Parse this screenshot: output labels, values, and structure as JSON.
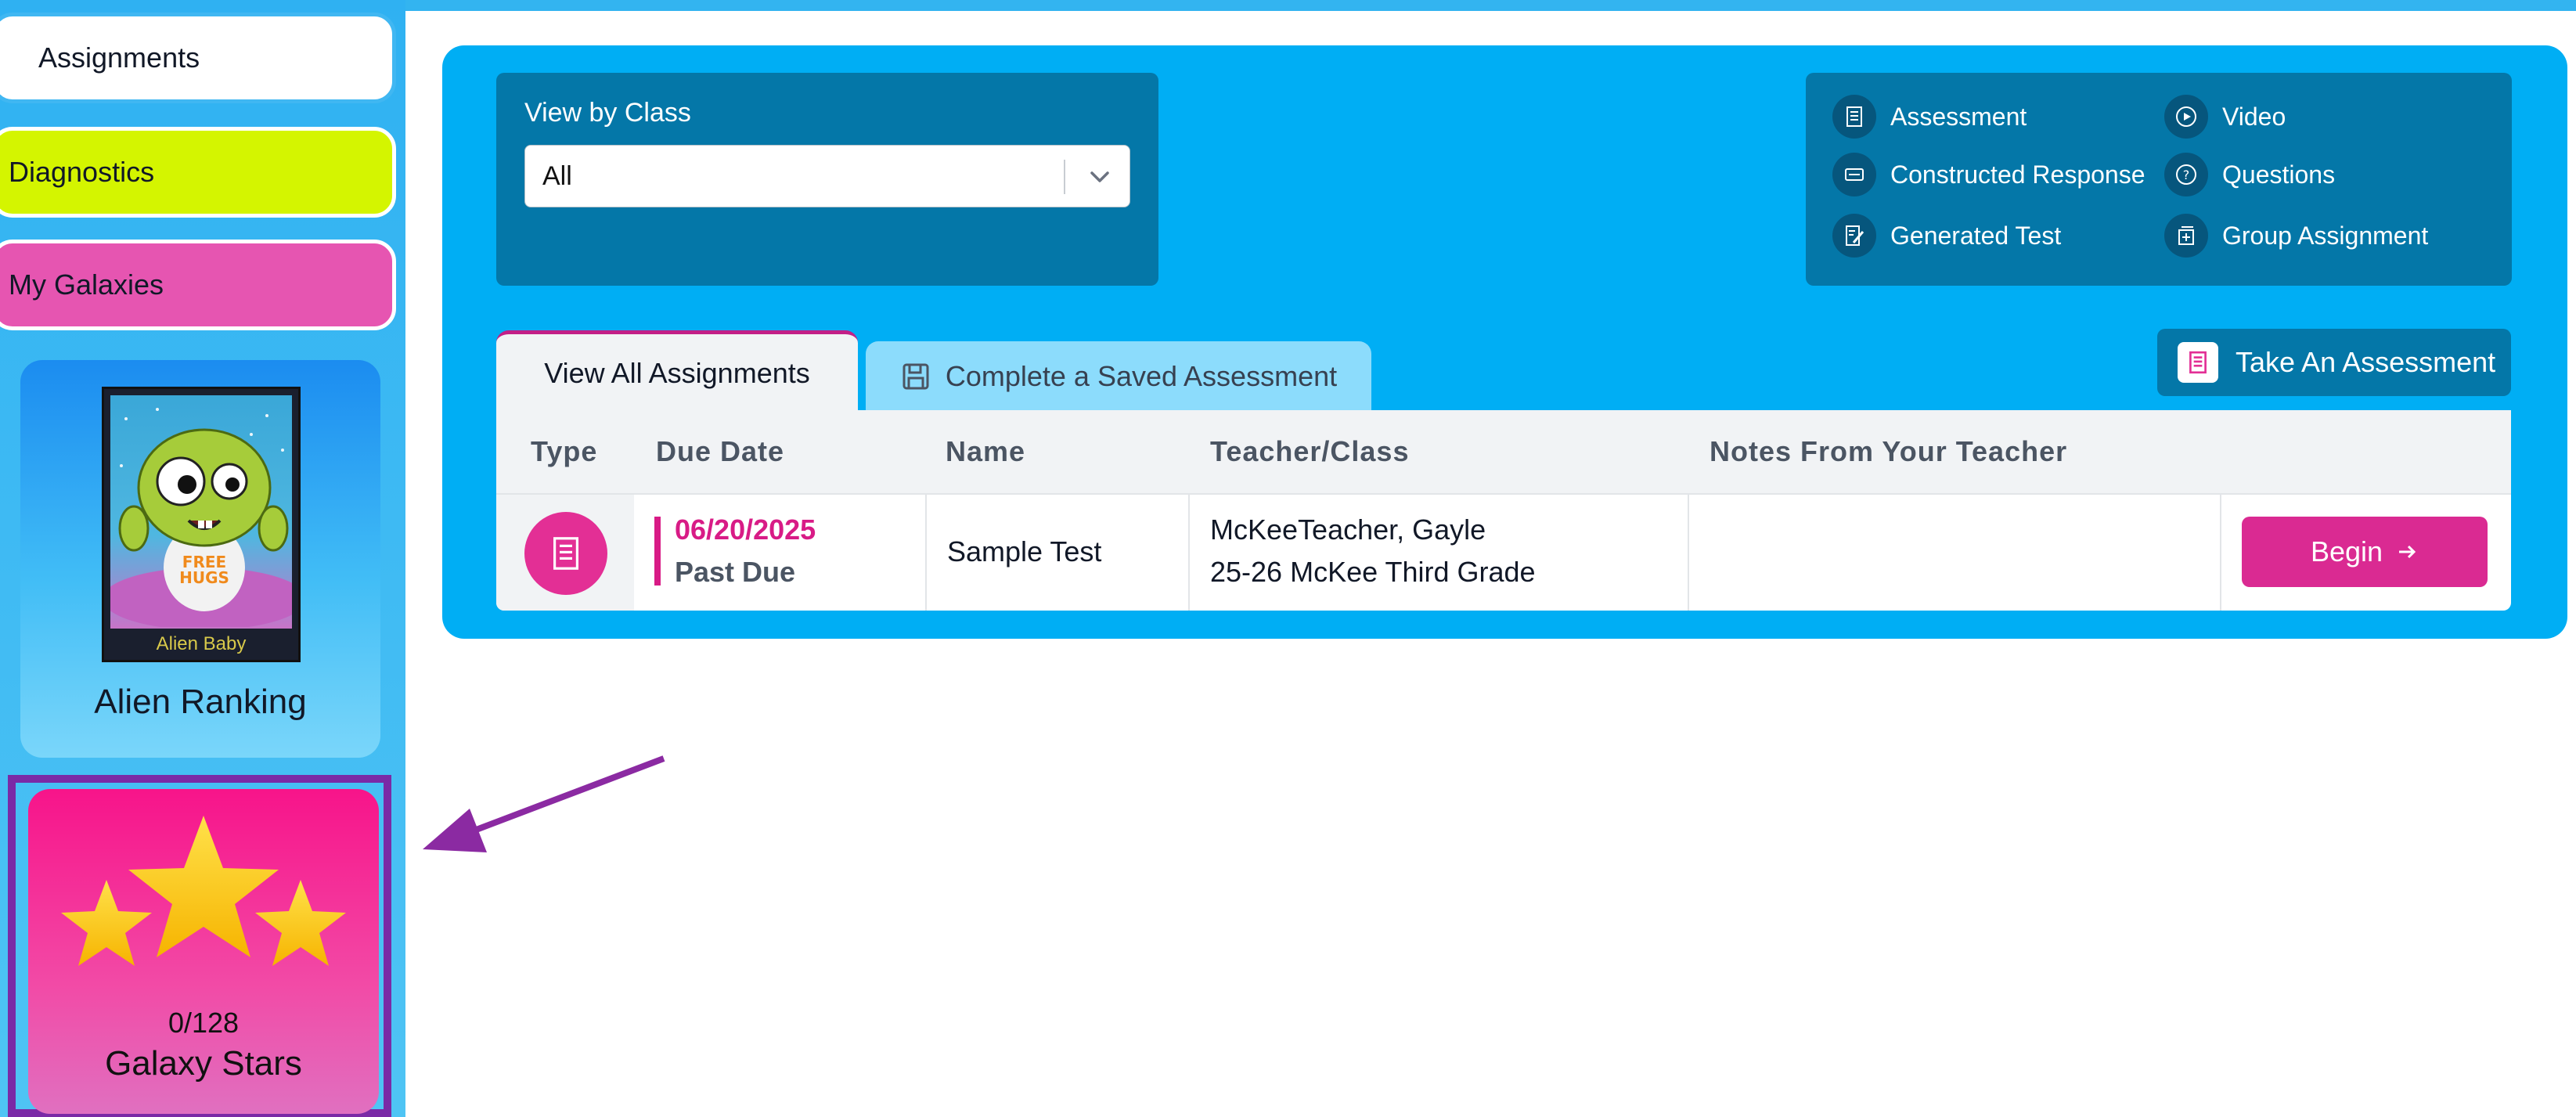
{
  "sidebar": {
    "nav": {
      "assignments": "Assignments",
      "diagnostics": "Diagnostics",
      "my_galaxies": "My Galaxies"
    },
    "alien_card": {
      "poster_label": "Alien Baby",
      "title": "Alien Ranking"
    },
    "stars_card": {
      "count": "0/128",
      "title": "Galaxy Stars"
    }
  },
  "filter": {
    "label": "View by Class",
    "selected": "All"
  },
  "legend": {
    "assessment": "Assessment",
    "video": "Video",
    "constructed_response": "Constructed Response",
    "questions": "Questions",
    "generated_test": "Generated Test",
    "group_assignment": "Group Assignment"
  },
  "take_assessment_label": "Take An Assessment",
  "tabs": {
    "view_all": "View All Assignments",
    "complete_saved": "Complete a Saved Assessment"
  },
  "table": {
    "headers": {
      "type": "Type",
      "due_date": "Due Date",
      "name": "Name",
      "teacher_class": "Teacher/Class",
      "notes": "Notes From Your Teacher"
    },
    "rows": [
      {
        "type_icon": "assessment-icon",
        "due_date": "06/20/2025",
        "status": "Past Due",
        "name": "Sample Test",
        "teacher": "McKeeTeacher, Gayle",
        "class": "25-26 McKee Third Grade",
        "notes": "",
        "action": "Begin"
      }
    ]
  },
  "colors": {
    "panel": "#00aef4",
    "dark_box": "#0477a8",
    "accent_pink": "#da2a92",
    "diagnostics_bg": "#d4f500",
    "galaxies_bg": "#e655b1",
    "arrow": "#8b2aa2"
  }
}
